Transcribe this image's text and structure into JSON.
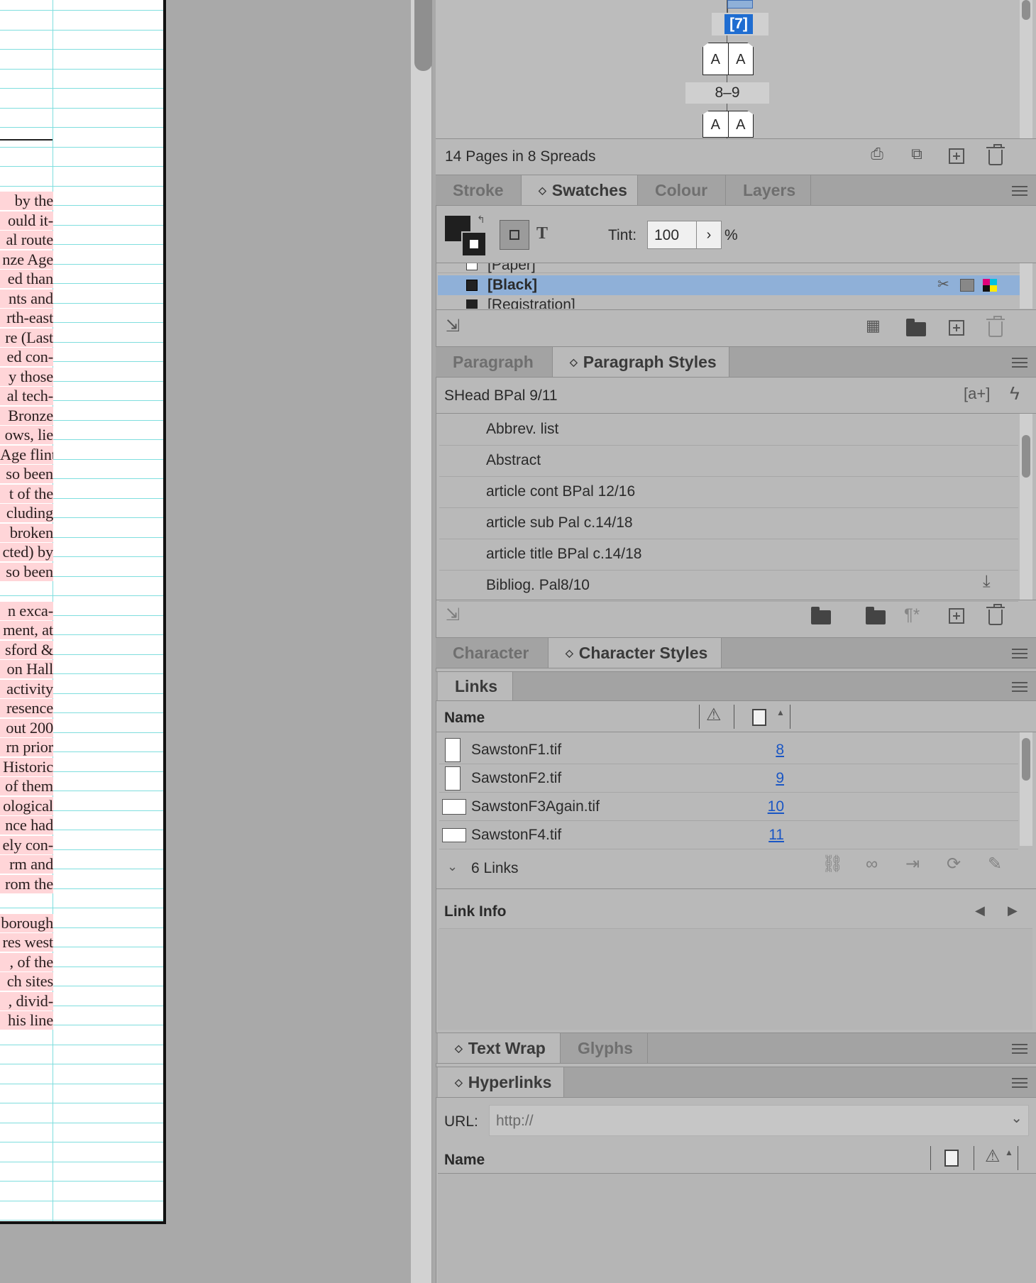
{
  "document": {
    "text_lines": [
      "by the",
      "ould it-",
      "al route",
      "nze Age",
      "ed than",
      "nts and",
      "rth-east",
      "re (Last",
      "ed con-",
      "y those",
      "al tech-",
      "Bronze",
      "ows, lie",
      "Age flint",
      "so been",
      "t of the",
      "cluding",
      "broken",
      "cted) by",
      "so been",
      "",
      "n exca-",
      "ment, at",
      "sford &",
      "on Hall",
      "activity",
      "resence",
      "out 200",
      "rn prior",
      "Historic",
      "of them",
      "ological",
      "nce had",
      "ely con-",
      "rm and",
      "rom the",
      "",
      "borough",
      "res west",
      ", of the",
      "ch sites",
      ", divid-",
      "his line"
    ]
  },
  "pages_panel": {
    "spread_7_label": "[7]",
    "spread_89_label": "8–9",
    "master_letter": "A",
    "footer_text": "14 Pages in 8 Spreads"
  },
  "swatches_panel": {
    "tabs": [
      "Stroke",
      "Swatches",
      "Colour",
      "Layers"
    ],
    "active_tab": "Swatches",
    "tint_label": "Tint:",
    "tint_value": "100",
    "tint_unit": "%",
    "items": [
      "[Paper]",
      "[Black]",
      "[Registration]"
    ],
    "selected": "[Black]"
  },
  "paragraph_panel": {
    "tabs": [
      "Paragraph",
      "Paragraph Styles"
    ],
    "active_tab": "Paragraph Styles",
    "current_style": "SHead BPal 9/11",
    "styles": [
      "Abbrev. list",
      "Abstract",
      "article cont BPal 12/16",
      "article sub  Pal c.14/18",
      "article title BPal c.14/18",
      "Bibliog. Pal8/10"
    ]
  },
  "character_panel": {
    "tabs": [
      "Character",
      "Character Styles"
    ],
    "active_tab": "Character Styles"
  },
  "links_panel": {
    "title": "Links",
    "col_name": "Name",
    "rows": [
      {
        "name": "SawstonF1.tif",
        "page": "8"
      },
      {
        "name": "SawstonF2.tif",
        "page": "9"
      },
      {
        "name": "SawstonF3Again.tif",
        "page": "10"
      },
      {
        "name": "SawstonF4.tif",
        "page": "11"
      }
    ],
    "count_label": "6 Links",
    "link_info_label": "Link Info"
  },
  "textwrap_panel": {
    "tabs": [
      "Text Wrap",
      "Glyphs"
    ],
    "active_tab": "Text Wrap"
  },
  "hyperlinks_panel": {
    "title": "Hyperlinks",
    "url_label": "URL:",
    "url_value": "http://",
    "col_name": "Name"
  },
  "colors": {
    "selection": "#8fb0d8",
    "link_blue": "#1a56c4",
    "page_highlight": "#ffd5d8",
    "guide_cyan": "#7fdede"
  }
}
